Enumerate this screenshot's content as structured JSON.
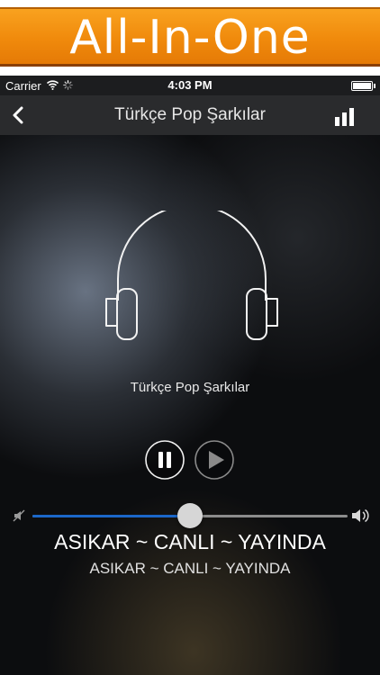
{
  "banner": {
    "title": "All-In-One"
  },
  "statusbar": {
    "carrier": "Carrier",
    "time": "4:03 PM"
  },
  "navbar": {
    "title": "Türkçe Pop Şarkılar"
  },
  "player": {
    "station_name": "Türkçe Pop Şarkılar",
    "volume": 0.5,
    "song_title": "ASIKAR ~ CANLI ~ YAYINDA",
    "song_subtitle": "ASIKAR ~ CANLI ~ YAYINDA"
  },
  "colors": {
    "banner": "#f08a0c",
    "slider_fill": "#1b67c9",
    "navbar": "#2a2b2d"
  },
  "icons": [
    "wifi-icon",
    "activity-spinner-icon",
    "battery-icon",
    "back-chevron-icon",
    "equalizer-bars-icon",
    "headphones-icon",
    "pause-icon",
    "play-icon",
    "volume-mute-icon",
    "volume-high-icon"
  ]
}
